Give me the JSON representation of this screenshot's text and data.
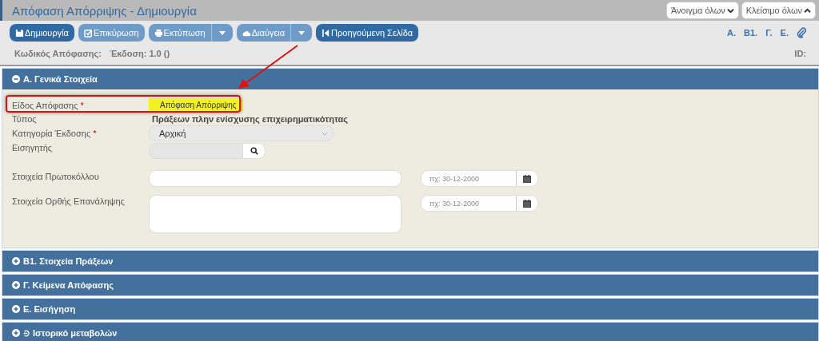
{
  "window": {
    "title": "Απόφαση Απόρριψης - Δημιουργία"
  },
  "header_buttons": [
    {
      "label": "Άνοιγμα όλων",
      "kind": "down"
    },
    {
      "label": "Κλείσιμο όλων",
      "kind": "up"
    }
  ],
  "toolbar": [
    {
      "label": "Δημιουργία",
      "kind": "save",
      "primary": true,
      "dropdown": false
    },
    {
      "label": "Επικύρωση",
      "kind": "check",
      "primary": false,
      "dropdown": false
    },
    {
      "label": "Εκτύπωση",
      "kind": "print",
      "primary": false,
      "dropdown": true
    },
    {
      "label": "Διαύγεια",
      "kind": "cloud",
      "primary": false,
      "dropdown": true
    },
    {
      "label": "Προηγούμενη Σελίδα",
      "kind": "back",
      "primary": true,
      "dropdown": false
    }
  ],
  "nav_links": [
    "Α.",
    "Β1.",
    "Γ.",
    "Ε."
  ],
  "info": {
    "code_label": "Κωδικός Απόφασης:",
    "version": "Έκδοση: 1.0  ()",
    "id_label": "ID:"
  },
  "sections": [
    {
      "title": "Α. Γενικά Στοιχεία",
      "expanded": true,
      "kind": "section",
      "fields": [
        {
          "label": "Είδος Απόφασης",
          "required_mark": "*",
          "kind": "text",
          "value": "Απόφαση Απόρριψης",
          "highlighted": true
        },
        {
          "label": "Τύπος",
          "kind": "text",
          "value": "Πράξεων πλην ενίσχυσης επιχειρηματικότητας",
          "highlighted": false
        },
        {
          "label": "Κατηγορία Έκδοσης",
          "required_mark": "*",
          "kind": "select",
          "value": "Αρχική"
        },
        {
          "label": "Εισηγητής",
          "kind": "lookup"
        },
        {
          "label": "Στοιχεία Πρωτοκόλλου",
          "kind": "input",
          "date_placeholder": "πχ: 30-12-2000"
        },
        {
          "label": "Στοιχεία Ορθής Επανάληψης",
          "kind": "textarea",
          "date_placeholder": "πχ: 30-12-2000"
        }
      ]
    },
    {
      "title": "Β1. Στοιχεία Πράξεων",
      "expanded": false,
      "kind": "section"
    },
    {
      "title": "Γ. Κείμενα Απόφασης",
      "expanded": false,
      "kind": "section"
    },
    {
      "title": "Ε. Εισήγηση",
      "expanded": false,
      "kind": "section"
    },
    {
      "title": "Ιστορικό μεταβολών",
      "expanded": false,
      "kind": "history"
    }
  ]
}
